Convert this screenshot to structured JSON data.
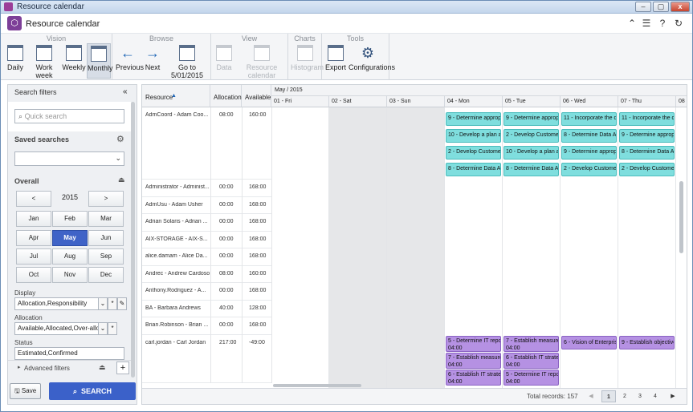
{
  "window": {
    "title": "Resource calendar",
    "btn_min": "–",
    "btn_max": "▢",
    "btn_close": "x"
  },
  "app": {
    "title": "Resource calendar"
  },
  "ribbon": {
    "groups": [
      "Vision",
      "Browse",
      "View",
      "Charts",
      "Tools"
    ],
    "vision": [
      "Daily",
      "Work week",
      "Weekly",
      "Monthly"
    ],
    "browse": {
      "previous": "Previous",
      "next": "Next",
      "goto": "Go to 5/01/2015"
    },
    "view": [
      "Data",
      "Resource calendar"
    ],
    "charts": [
      "Histogram"
    ],
    "tools": [
      "Export",
      "Configurations"
    ]
  },
  "filters": {
    "title": "Search filters",
    "quick_search_placeholder": "Quick search",
    "saved_searches": "Saved searches",
    "overall": "Overall",
    "year": "2015",
    "prev": "<",
    "next": ">",
    "months": [
      "Jan",
      "Feb",
      "Mar",
      "Apr",
      "May",
      "Jun",
      "Jul",
      "Aug",
      "Sep",
      "Oct",
      "Nov",
      "Dec"
    ],
    "selected_month": "May",
    "display_label": "Display",
    "display_value": "Allocation,Responsibility",
    "allocation_label": "Allocation",
    "allocation_value": "Available,Allocated,Over-allo",
    "status_label": "Status",
    "status_value": "Estimated,Confirmed",
    "advanced": "Advanced filters",
    "save": "Save",
    "search": "SEARCH"
  },
  "grid": {
    "col_resource": "Resource",
    "col_allocation": "Allocation",
    "col_available": "Available",
    "period": "May / 2015",
    "days": [
      "01 - Fri",
      "02 - Sat",
      "03 - Sun",
      "04 - Mon",
      "05 - Tue",
      "06 - Wed",
      "07 - Thu",
      "08"
    ],
    "rows": [
      {
        "name": "AdmCoord - Adam Coo...",
        "alloc": "08:00",
        "avail": "160:00"
      },
      {
        "name": "Administrator - Administ...",
        "alloc": "00:00",
        "avail": "168:00"
      },
      {
        "name": "AdmUsu - Adam Usher",
        "alloc": "00:00",
        "avail": "168:00"
      },
      {
        "name": "Adrian Solaris - Adrian ...",
        "alloc": "00:00",
        "avail": "168:00"
      },
      {
        "name": "AIX-STORAGE - AIX-S...",
        "alloc": "00:00",
        "avail": "168:00"
      },
      {
        "name": "alice.damam - Alice Da...",
        "alloc": "00:00",
        "avail": "168:00"
      },
      {
        "name": "Andrec - Andrew Cardoso",
        "alloc": "08:00",
        "avail": "160:00"
      },
      {
        "name": "Anthony.Rodriguez - A...",
        "alloc": "00:00",
        "avail": "168:00"
      },
      {
        "name": "BA - Barbara Andrews",
        "alloc": "40:00",
        "avail": "128:00"
      },
      {
        "name": "Brian.Robinson - Brian ...",
        "alloc": "00:00",
        "avail": "168:00"
      },
      {
        "name": "carl.jordan - Carl Jordan",
        "alloc": "217:00",
        "avail": "-49:00"
      }
    ],
    "events_cyan": [
      [
        "9 - Determine appropri",
        "9 - Determine appropri",
        "11 - Incorporate the de",
        "11 - Incorporate the de"
      ],
      [
        "10 - Develop a plan an",
        "2 - Develop Customer",
        "8 - Determine Data An",
        "9 - Determine appropri"
      ],
      [
        "2 - Develop Customer",
        "10 - Develop a plan an",
        "9 - Determine appropri",
        "8 - Determine Data An"
      ],
      [
        "8 - Determine Data An",
        "8 - Determine Data An",
        "2 - Develop Customer",
        "2 - Develop Customer"
      ]
    ],
    "events_purple": [
      {
        "col": 0,
        "row": 0,
        "text": "5 - Determine IT repor",
        "time": "04:00"
      },
      {
        "col": 1,
        "row": 0,
        "text": "7 - Establish measurer",
        "time": "04:00"
      },
      {
        "col": 2,
        "row": 0,
        "text": "6 - Vision of Enterprise",
        "time": ""
      },
      {
        "col": 3,
        "row": 0,
        "text": "9 - Establish objectives",
        "time": ""
      },
      {
        "col": 0,
        "row": 1,
        "text": "7 - Establish measurer",
        "time": "04:00"
      },
      {
        "col": 1,
        "row": 1,
        "text": "6 - Establish IT strateg",
        "time": "04:00"
      },
      {
        "col": 0,
        "row": 2,
        "text": "6 - Establish IT strateg",
        "time": "04:00"
      },
      {
        "col": 1,
        "row": 2,
        "text": "5 - Determine IT repor",
        "time": "04:00"
      }
    ]
  },
  "footer": {
    "total": "Total records: 157",
    "pages": [
      "1",
      "2",
      "3",
      "4"
    ],
    "first": "◀",
    "last": "▶"
  },
  "colors": {
    "accent": "#3b61c9",
    "cyan_event": "#7fdede",
    "purple_event": "#b591e3"
  }
}
